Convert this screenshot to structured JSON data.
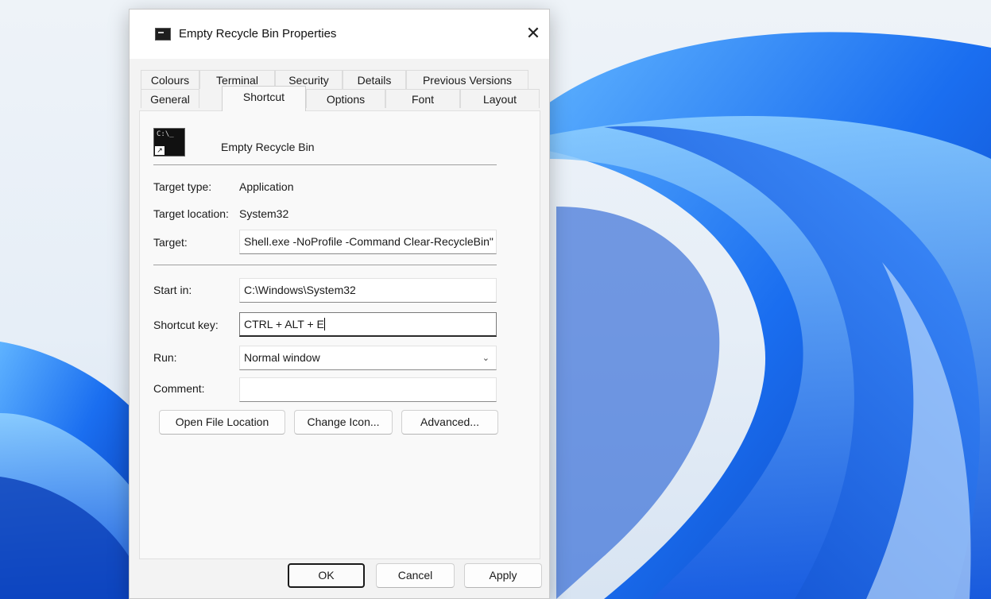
{
  "dialog": {
    "title": "Empty Recycle Bin Properties",
    "close_label": "✕"
  },
  "tabs": {
    "row1": [
      "Colours",
      "Terminal",
      "Security",
      "Details",
      "Previous Versions"
    ],
    "row2": [
      "General",
      "Shortcut",
      "Options",
      "Font",
      "Layout"
    ],
    "active": "Shortcut"
  },
  "shortcut": {
    "icon_text": "C:\\_",
    "arrow_glyph": "↗",
    "name": "Empty Recycle Bin",
    "target_type_label": "Target type:",
    "target_type_value": "Application",
    "target_location_label": "Target location:",
    "target_location_value": "System32",
    "target_label": "Target:",
    "target_value": "Shell.exe -NoProfile -Command Clear-RecycleBin\"",
    "start_in_label": "Start in:",
    "start_in_value": "C:\\Windows\\System32",
    "shortcut_key_label": "Shortcut key:",
    "shortcut_key_value": "CTRL + ALT + E",
    "run_label": "Run:",
    "run_value": "Normal window",
    "comment_label": "Comment:",
    "comment_value": ""
  },
  "actions": {
    "open_file_location": "Open File Location",
    "change_icon": "Change Icon...",
    "advanced": "Advanced..."
  },
  "footer": {
    "ok": "OK",
    "cancel": "Cancel",
    "apply": "Apply"
  },
  "icons": {
    "chevron": "chevron-down-icon",
    "close": "close-icon",
    "app": "terminal-icon"
  },
  "colors": {
    "wallpaper_blue": "#1565e0",
    "dialog_bg": "#f3f3f3"
  }
}
